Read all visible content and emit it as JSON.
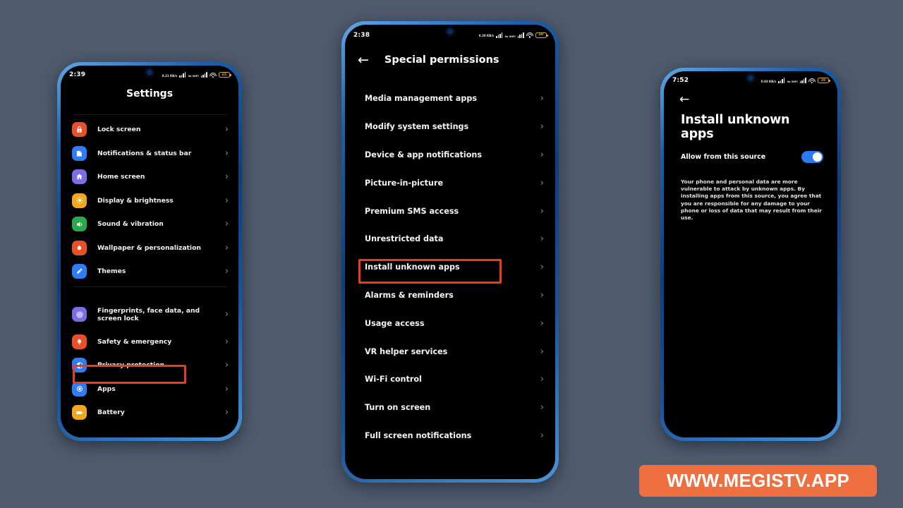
{
  "background_color": "#4e5b6e",
  "accent_highlight_color": "#ef3b19",
  "toggle_on_color": "#2a7bf0",
  "phone1": {
    "status": {
      "time": "2:39",
      "data_rate": "0.21 KB/s",
      "network": "Vo WiFi",
      "battery": "65"
    },
    "title": "Settings",
    "items": [
      {
        "label": "Lock screen",
        "icon": "lock-icon",
        "color": "#e8502a",
        "chevron": "›"
      },
      {
        "label": "Notifications & status bar",
        "icon": "notifications-icon",
        "color": "#2f7cf6",
        "chevron": "›"
      },
      {
        "label": "Home screen",
        "icon": "home-icon",
        "color": "#7b6ce8",
        "chevron": "›"
      },
      {
        "label": "Display & brightness",
        "icon": "brightness-icon",
        "color": "#f0a81e",
        "chevron": "›"
      },
      {
        "label": "Sound & vibration",
        "icon": "speaker-icon",
        "color": "#2aa84a",
        "chevron": "›"
      },
      {
        "label": "Wallpaper & personalization",
        "icon": "wallpaper-icon",
        "color": "#e8502a",
        "chevron": "›"
      },
      {
        "label": "Themes",
        "icon": "themes-icon",
        "color": "#2f7cf6",
        "chevron": "›"
      }
    ],
    "items2": [
      {
        "label": "Fingerprints, face data, and screen lock",
        "icon": "fingerprint-icon",
        "color": "#7b6ce8",
        "chevron": "›"
      },
      {
        "label": "Safety & emergency",
        "icon": "safety-icon",
        "color": "#e8502a",
        "chevron": "›"
      },
      {
        "label": "Privacy protection",
        "icon": "privacy-icon",
        "color": "#2f7cf6",
        "chevron": "›",
        "highlighted": true
      },
      {
        "label": "Apps",
        "icon": "apps-icon",
        "color": "#2f7cf6",
        "chevron": "›"
      },
      {
        "label": "Battery",
        "icon": "battery-icon",
        "color": "#f0a81e",
        "chevron": "›"
      }
    ]
  },
  "phone2": {
    "status": {
      "time": "2:38",
      "data_rate": "0.28 KB/s",
      "network": "Vo WiFi",
      "battery": "69"
    },
    "back_icon": "←",
    "title": "Special permissions",
    "items": [
      {
        "label": "Media management apps",
        "chevron": "›"
      },
      {
        "label": "Modify system settings",
        "chevron": "›"
      },
      {
        "label": "Device & app notifications",
        "chevron": "›"
      },
      {
        "label": "Picture-in-picture",
        "chevron": "›"
      },
      {
        "label": "Premium SMS access",
        "chevron": "›"
      },
      {
        "label": "Unrestricted data",
        "chevron": "›"
      },
      {
        "label": "Install unknown apps",
        "chevron": "›",
        "highlighted": true
      },
      {
        "label": "Alarms & reminders",
        "chevron": "›"
      },
      {
        "label": "Usage access",
        "chevron": "›"
      },
      {
        "label": "VR helper services",
        "chevron": "›"
      },
      {
        "label": "Wi-Fi control",
        "chevron": "›"
      },
      {
        "label": "Turn on screen",
        "chevron": "›"
      },
      {
        "label": "Full screen notifications",
        "chevron": "›"
      }
    ]
  },
  "phone3": {
    "status": {
      "time": "7:52",
      "data_rate": "0.03 KB/s",
      "network": "Vo WiFi",
      "battery": "29"
    },
    "back_icon": "←",
    "title": "Install unknown apps",
    "allow_label": "Allow from this source",
    "toggle_state": "on",
    "warning": "Your phone and personal data are more vulnerable to attack by unknown apps. By installing apps from this source, you agree that you are responsible for any damage to your phone or loss of data that may result from their use."
  },
  "watermark": {
    "text": "WWW.MEGISTV.APP",
    "color": "#ee7040"
  }
}
